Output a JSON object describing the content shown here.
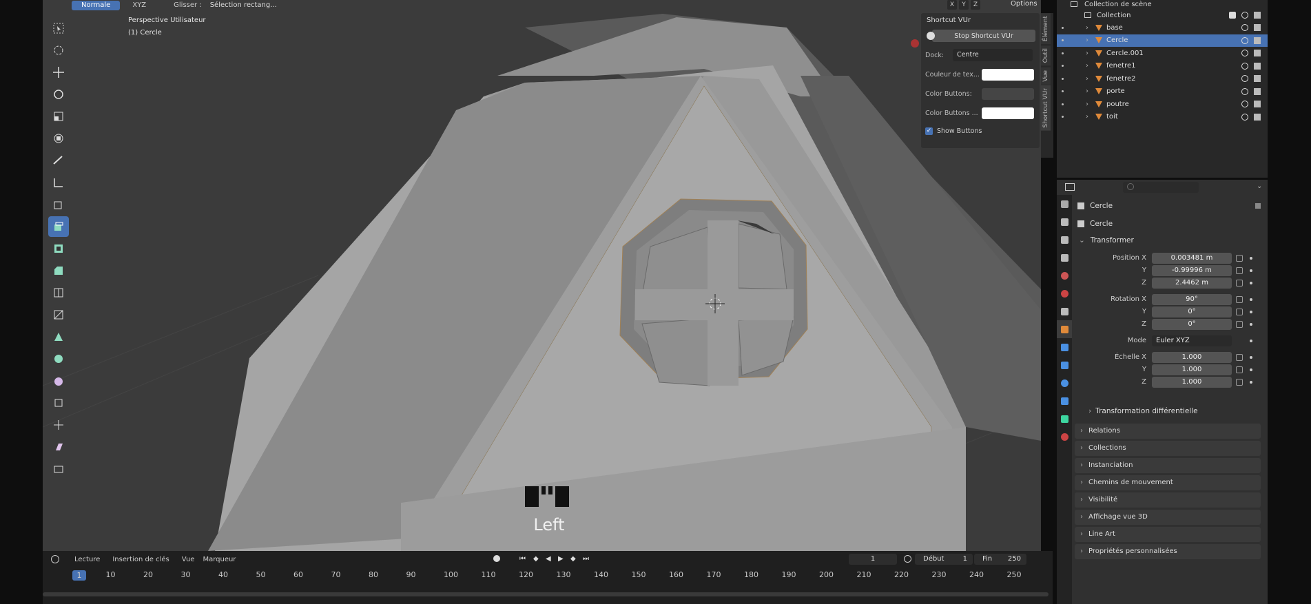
{
  "header": {
    "mode": "Normale",
    "orientation": "XYZ",
    "drag_label": "Glisser :",
    "drag_value": "Sélection rectang...",
    "axis_x": "X",
    "axis_y": "Y",
    "axis_z": "Z",
    "options": "Options"
  },
  "viewport": {
    "view_name": "Perspective Utilisateur",
    "object_name": "(1) Cercle",
    "keycast_text": "Left"
  },
  "npanel": {
    "title": "Shortcut VUr",
    "stop_button": "Stop Shortcut VUr",
    "dock_label": "Dock:",
    "dock_value": "Centre",
    "text_color_label": "Couleur de tex...",
    "color_buttons_label": "Color Buttons:",
    "color_buttons2_label": "Color Buttons ...",
    "show_buttons": "Show Buttons",
    "tabs": [
      "Élément",
      "Outil",
      "Vue",
      "Shortcut VUr"
    ]
  },
  "outliner": {
    "scene_collection": "Collection de scène",
    "collection": "Collection",
    "items": [
      {
        "name": "base"
      },
      {
        "name": "Cercle"
      },
      {
        "name": "Cercle.001"
      },
      {
        "name": "fenetre1"
      },
      {
        "name": "fenetre2"
      },
      {
        "name": "porte"
      },
      {
        "name": "poutre"
      },
      {
        "name": "toit"
      }
    ]
  },
  "properties": {
    "object_title": "Cercle",
    "object_field": "Cercle",
    "transform_header": "Transformer",
    "position_x_label": "Position X",
    "position_x": "0.003481 m",
    "position_y": "-0.99996 m",
    "position_z": "2.4462 m",
    "rotation_x_label": "Rotation X",
    "rotation_x": "90°",
    "rotation_y": "0°",
    "rotation_z": "0°",
    "mode_label": "Mode",
    "mode_value": "Euler XYZ",
    "scale_x_label": "Échelle X",
    "scale_x": "1.000",
    "scale_y": "1.000",
    "scale_z": "1.000",
    "y_label": "Y",
    "z_label": "Z",
    "delta_transform": "Transformation différentielle",
    "sections": [
      "Relations",
      "Collections",
      "Instanciation",
      "Chemins de mouvement",
      "Visibilité",
      "Affichage vue 3D",
      "Line Art",
      "Propriétés personnalisées"
    ]
  },
  "timeline": {
    "playback": "Lecture",
    "keying": "Insertion de clés",
    "view": "Vue",
    "marker": "Marqueur",
    "current_frame": "1",
    "start_label": "Début",
    "start_value": "1",
    "end_label": "Fin",
    "end_value": "250",
    "ruler": [
      "1",
      "10",
      "20",
      "30",
      "40",
      "50",
      "60",
      "70",
      "80",
      "90",
      "100",
      "110",
      "120",
      "130",
      "140",
      "150",
      "160",
      "170",
      "180",
      "190",
      "200",
      "210",
      "220",
      "230",
      "240",
      "250"
    ]
  },
  "colors": {
    "accent": "#4772b3",
    "object_icon": "#e08a3a",
    "mesh_icon": "#3dd6a0"
  }
}
